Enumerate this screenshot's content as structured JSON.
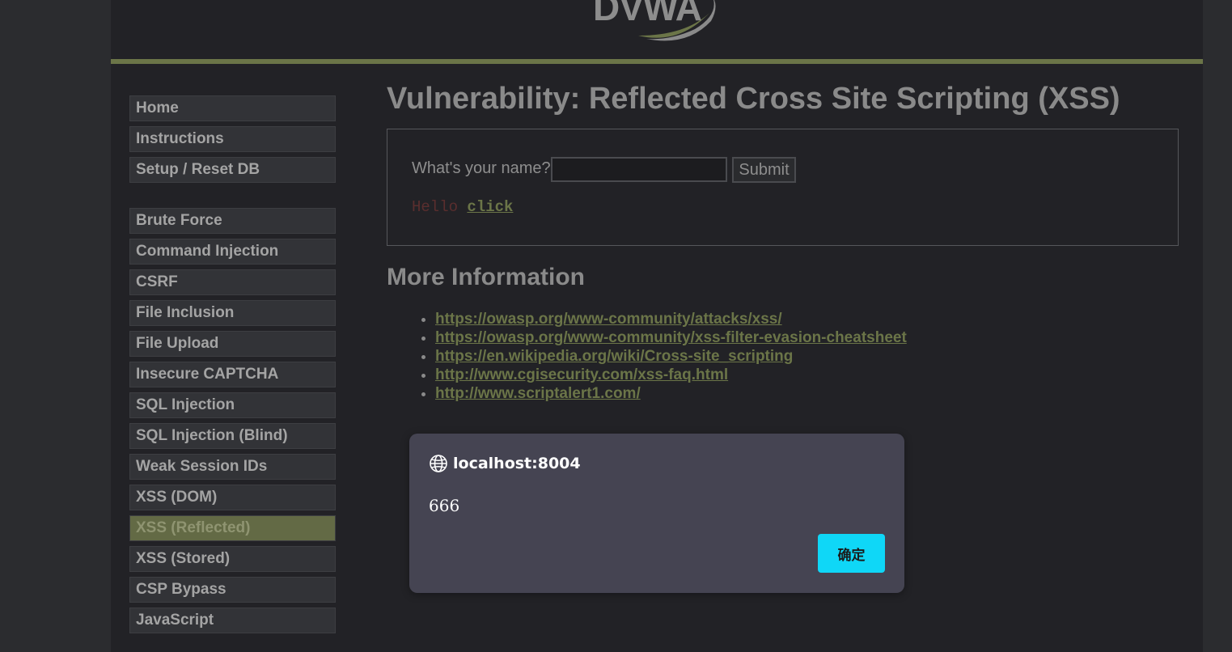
{
  "header": {
    "logo_text": "DVWA"
  },
  "menu": {
    "group1": [
      {
        "label": "Home"
      },
      {
        "label": "Instructions"
      },
      {
        "label": "Setup / Reset DB"
      }
    ],
    "group2": [
      {
        "label": "Brute Force"
      },
      {
        "label": "Command Injection"
      },
      {
        "label": "CSRF"
      },
      {
        "label": "File Inclusion"
      },
      {
        "label": "File Upload"
      },
      {
        "label": "Insecure CAPTCHA"
      },
      {
        "label": "SQL Injection"
      },
      {
        "label": "SQL Injection (Blind)"
      },
      {
        "label": "Weak Session IDs"
      },
      {
        "label": "XSS (DOM)"
      },
      {
        "label": "XSS (Reflected)",
        "active": true
      },
      {
        "label": "XSS (Stored)"
      },
      {
        "label": "CSP Bypass"
      },
      {
        "label": "JavaScript"
      }
    ]
  },
  "main": {
    "title": "Vulnerability: Reflected Cross Site Scripting (XSS)",
    "form": {
      "name_label": "What's your name?",
      "name_value": "",
      "submit_label": "Submit"
    },
    "result": {
      "hello": "Hello ",
      "link": "click"
    },
    "more_info": {
      "title": "More Information",
      "links": [
        "https://owasp.org/www-community/attacks/xss/",
        "https://owasp.org/www-community/xss-filter-evasion-cheatsheet",
        "https://en.wikipedia.org/wiki/Cross-site_scripting",
        "http://www.cgisecurity.com/xss-faq.html",
        "http://www.scriptalert1.com/"
      ]
    }
  },
  "alert": {
    "origin": "localhost:8004",
    "message": "666",
    "ok_label": "确定",
    "icon": "globe-icon"
  },
  "colors": {
    "accent": "#6b7548",
    "dialog_button": "#0fd7f7",
    "dialog_bg": "#454452"
  }
}
